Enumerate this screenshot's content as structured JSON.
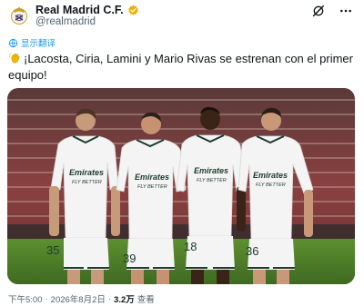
{
  "account": {
    "display_name": "Real Madrid C.F.",
    "handle": "@realmadrid",
    "verified_color": "#e8b30e",
    "avatar_icon": "real-madrid-crest-icon"
  },
  "toolbar": {
    "grok_icon": "grok-icon",
    "more_icon": "more-options-icon"
  },
  "translate_label": "显示翻译",
  "tweet": {
    "text": "¡Lacosta, Ciria, Lamini y Mario Rivas se estrenan con el primer equipo!",
    "emoji": "waving-hand-emoji"
  },
  "media": {
    "shirt_sponsor_line1": "Emirates",
    "shirt_sponsor_line2": "FLY BETTER",
    "players": [
      {
        "number": "35"
      },
      {
        "number": "39"
      },
      {
        "number": "18"
      },
      {
        "number": "36"
      }
    ]
  },
  "footer": {
    "time": "下午5:00",
    "sep": "·",
    "date": "2026年8月2日",
    "views_count": "3.2万",
    "views_label": "查看"
  },
  "colors": {
    "link": "#1d9bf0",
    "muted": "#536471",
    "pitch": "#4f7f2a",
    "stands": "#7a3a3a"
  }
}
